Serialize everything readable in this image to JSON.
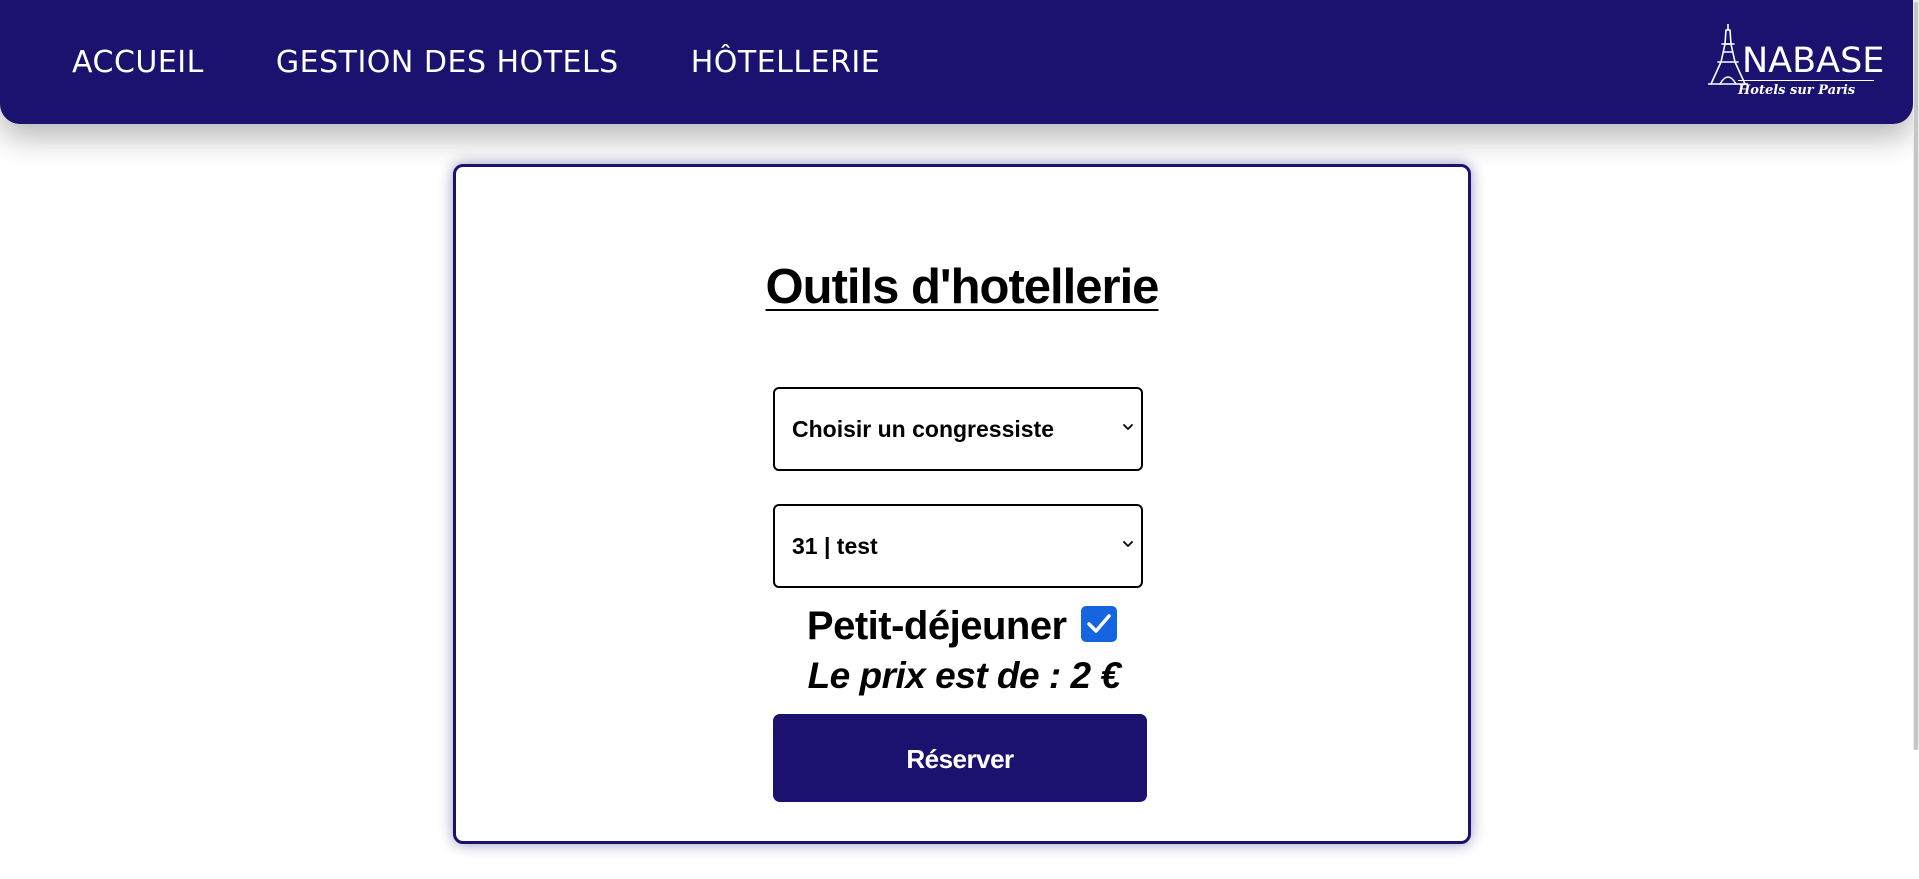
{
  "nav": {
    "items": [
      {
        "label": "ACCUEIL"
      },
      {
        "label": "GESTION DES HOTELS"
      },
      {
        "label": "HÔTELLERIE"
      }
    ]
  },
  "logo": {
    "main_text": "NABASE",
    "tagline": "Hotels sur Paris",
    "icon": "eiffel-tower-icon"
  },
  "card": {
    "title": "Outils d'hotellerie",
    "congressiste_select": {
      "selected": "Choisir un congressiste"
    },
    "hotel_select": {
      "selected": "31 | test"
    },
    "breakfast": {
      "label": "Petit-déjeuner",
      "checked": true
    },
    "price_text": "Le prix est de : 2 €",
    "reserve_label": "Réserver"
  },
  "colors": {
    "brand": "#1b1270",
    "checkbox_accent": "#1565e0",
    "background": "#ffffff"
  }
}
